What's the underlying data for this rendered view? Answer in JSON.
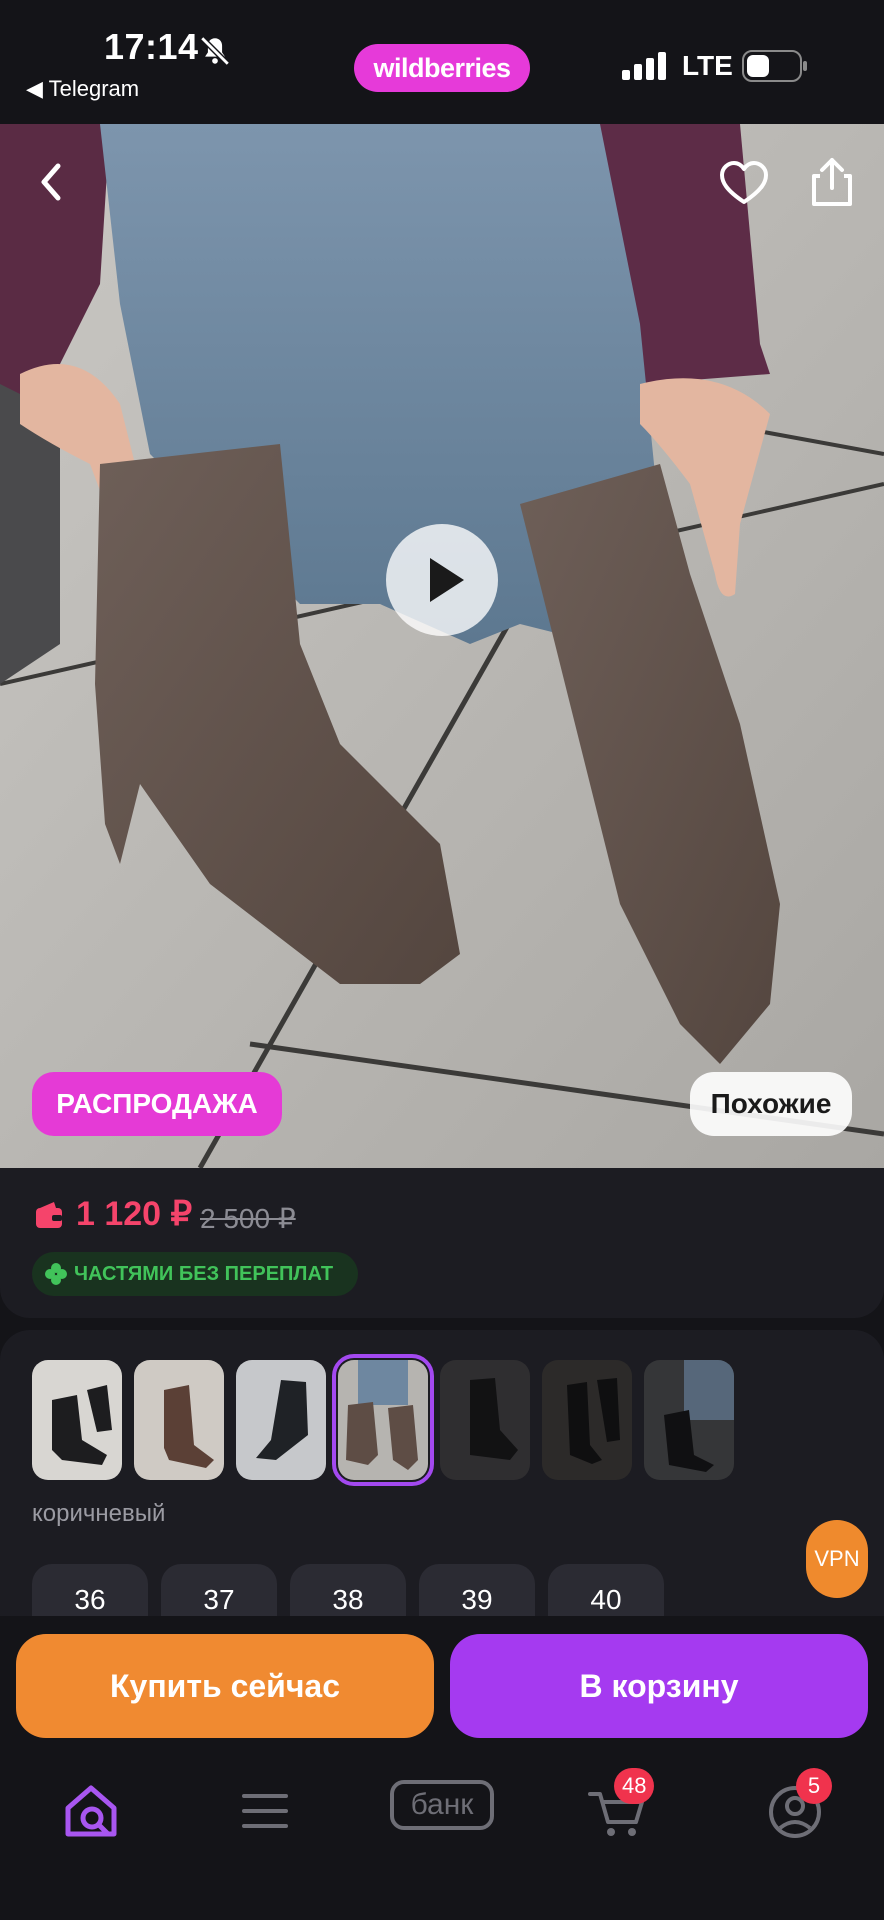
{
  "status_bar": {
    "time": "17:14",
    "back_app_label": "◀ Telegram",
    "brand": "wildberries",
    "network": "LTE"
  },
  "hero": {
    "sale_badge": "РАСПРОДАЖА",
    "similar_button": "Похожие",
    "icons": [
      "back-icon",
      "heart-icon",
      "share-icon",
      "play-icon"
    ]
  },
  "price": {
    "current": "1 120 ₽",
    "old": "2 500 ₽",
    "installments": "ЧАСТЯМИ БЕЗ ПЕРЕПЛАТ",
    "accent_color": "#f5446b"
  },
  "variants": {
    "selected_color": "коричневый",
    "selected_index": 3,
    "thumb_count": 7
  },
  "sizes": [
    "36",
    "37",
    "38",
    "39",
    "40"
  ],
  "vpn_label": "VPN",
  "actions": {
    "buy_now": "Купить сейчас",
    "add_to_cart": "В корзину"
  },
  "nav": {
    "bank_label": "банк",
    "cart_badge": "48",
    "profile_badge": "5",
    "icons": [
      "home-search-icon",
      "menu-icon",
      "bank-icon",
      "cart-icon",
      "profile-icon"
    ]
  }
}
